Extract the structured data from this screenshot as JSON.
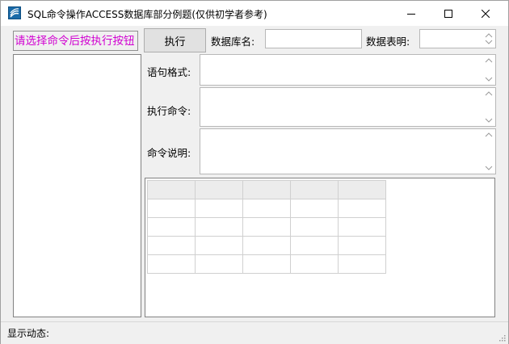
{
  "window": {
    "title": "SQL命令操作ACCESS数据库部分例题(仅供初学者参考)",
    "icons": [
      "app-icon",
      "minimize-icon",
      "maximize-icon",
      "close-icon"
    ]
  },
  "left_panel": {
    "hint": "请选择命令后按执行按钮",
    "hint_color": "#d100d1"
  },
  "toolbar": {
    "execute_label": "执行",
    "db_name_label": "数据库名:",
    "db_name_value": "",
    "table_name_label": "数据表明:",
    "table_name_value": ""
  },
  "fields": {
    "syntax_label": "语句格式:",
    "command_label": "执行命令:",
    "description_label": "命令说明:"
  },
  "status": {
    "label": "显示动态:"
  }
}
